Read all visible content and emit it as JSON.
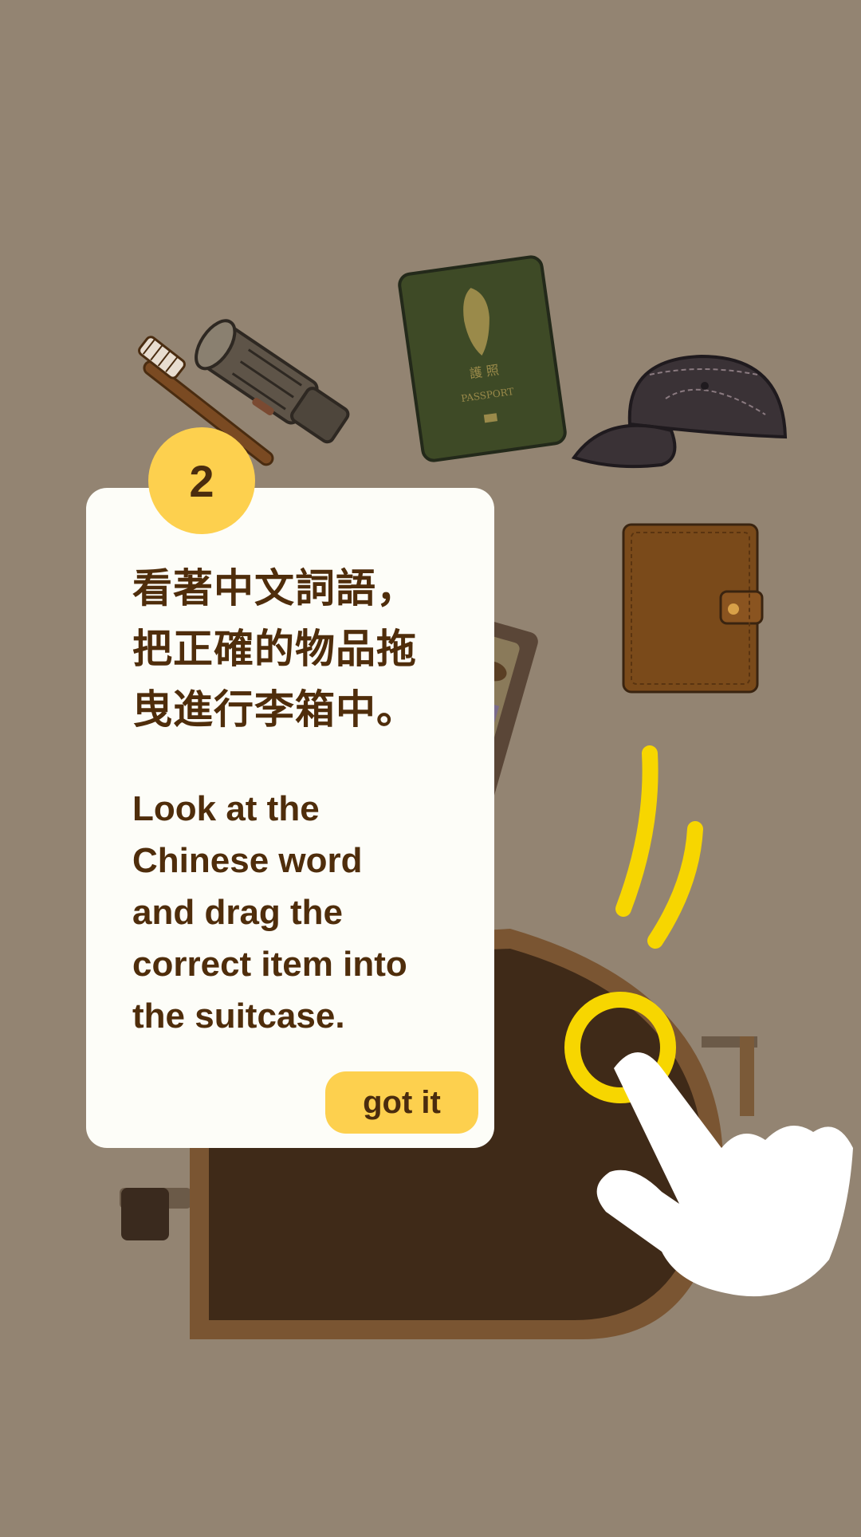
{
  "tutorial": {
    "step_number": "2",
    "instruction_zh_lines": [
      "看著中文詞語，",
      "把正確的物品拖",
      "曳進行李箱中。"
    ],
    "instruction_en_lines": [
      "Look at the",
      "Chinese word",
      "and drag the",
      "correct item into",
      "the suitcase."
    ],
    "dismiss_label": "got it"
  },
  "scene": {
    "items": [
      {
        "name": "toothbrush",
        "icon": "toothbrush-icon"
      },
      {
        "name": "flashlight",
        "icon": "flashlight-icon"
      },
      {
        "name": "passport",
        "icon": "passport-icon",
        "cover_text_zh": "護照",
        "cover_text_en": "PASSPORT"
      },
      {
        "name": "cap",
        "icon": "cap-icon"
      },
      {
        "name": "wallet",
        "icon": "wallet-icon"
      },
      {
        "name": "map",
        "icon": "map-icon"
      },
      {
        "name": "suitcase",
        "icon": "suitcase-icon"
      }
    ],
    "hint": {
      "icon": "pointing-hand-icon",
      "gesture": "drag"
    }
  },
  "colors": {
    "background": "#938472",
    "card": "#fdfdf8",
    "accent_yellow": "#fdd04e",
    "text_brown": "#4f2d0b",
    "tap_ring": "#f7d600",
    "suitcase": "#3f2a18"
  }
}
